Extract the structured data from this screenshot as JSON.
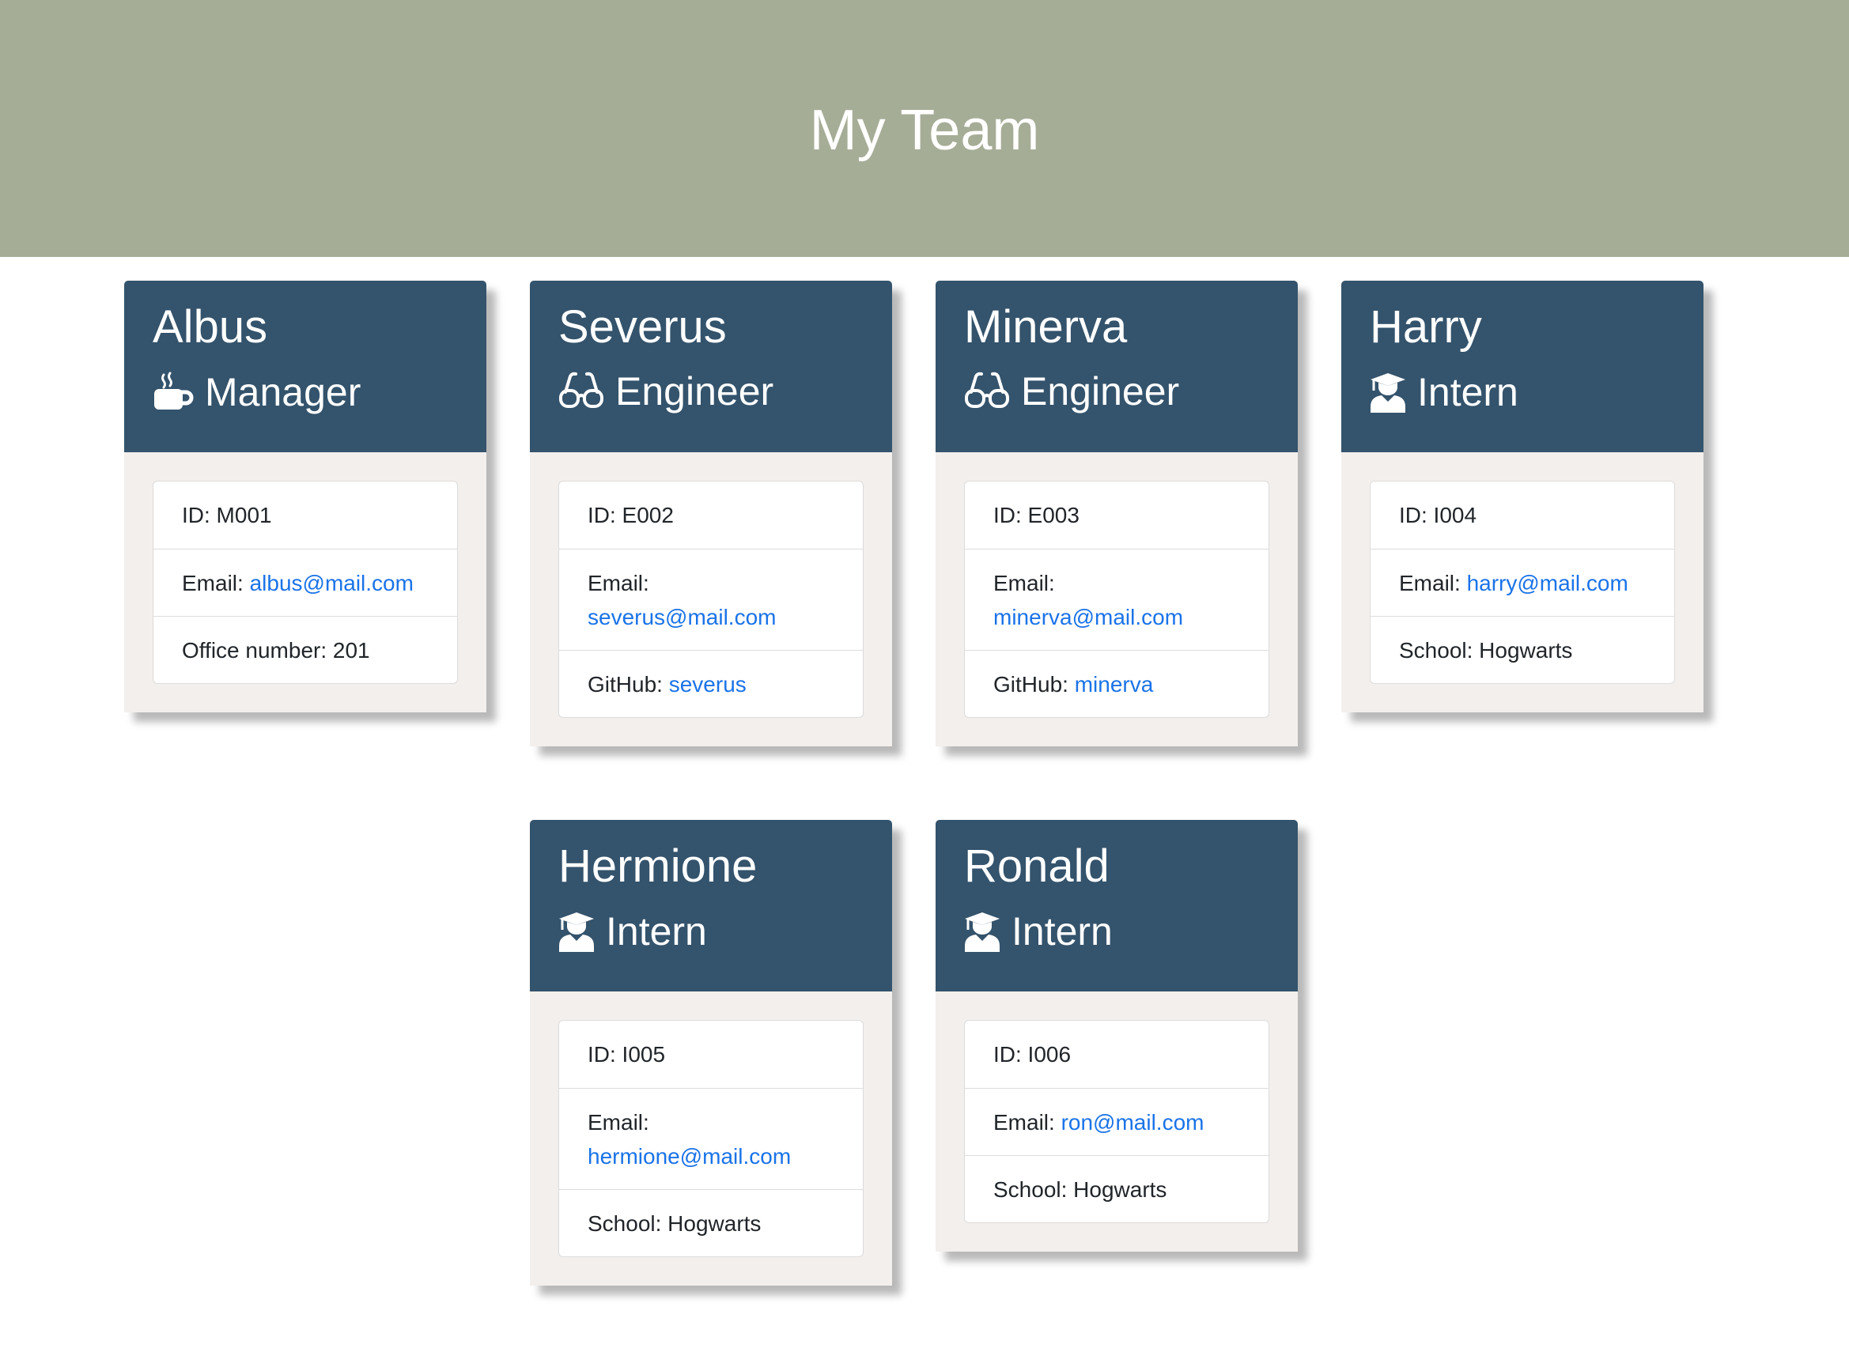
{
  "header": {
    "title": "My Team"
  },
  "colors": {
    "header_bg": "#a6ad97",
    "card_header_bg": "#34536c",
    "card_body_bg": "#f3efec",
    "link": "#1a73e8"
  },
  "members": [
    {
      "name": "Albus",
      "role": "Manager",
      "role_icon": "coffee-mug-icon",
      "id_text": "ID: M001",
      "email_label": "Email:",
      "email": "albus@mail.com",
      "extra_label": "Office number: 201"
    },
    {
      "name": "Severus",
      "role": "Engineer",
      "role_icon": "glasses-icon",
      "id_text": "ID: E002",
      "email_label": "Email:",
      "email": "severus@mail.com",
      "extra_label": "GitHub:",
      "extra_link": "severus"
    },
    {
      "name": "Minerva",
      "role": "Engineer",
      "role_icon": "glasses-icon",
      "id_text": "ID: E003",
      "email_label": "Email:",
      "email": "minerva@mail.com",
      "extra_label": "GitHub:",
      "extra_link": "minerva"
    },
    {
      "name": "Harry",
      "role": "Intern",
      "role_icon": "graduate-icon",
      "id_text": "ID: I004",
      "email_label": "Email:",
      "email": "harry@mail.com",
      "extra_label": "School: Hogwarts"
    },
    {
      "name": "Hermione",
      "role": "Intern",
      "role_icon": "graduate-icon",
      "id_text": "ID: I005",
      "email_label": "Email:",
      "email": "hermione@mail.com",
      "extra_label": "School: Hogwarts"
    },
    {
      "name": "Ronald",
      "role": "Intern",
      "role_icon": "graduate-icon",
      "id_text": "ID: I006",
      "email_label": "Email:",
      "email": "ron@mail.com",
      "extra_label": "School: Hogwarts"
    }
  ]
}
